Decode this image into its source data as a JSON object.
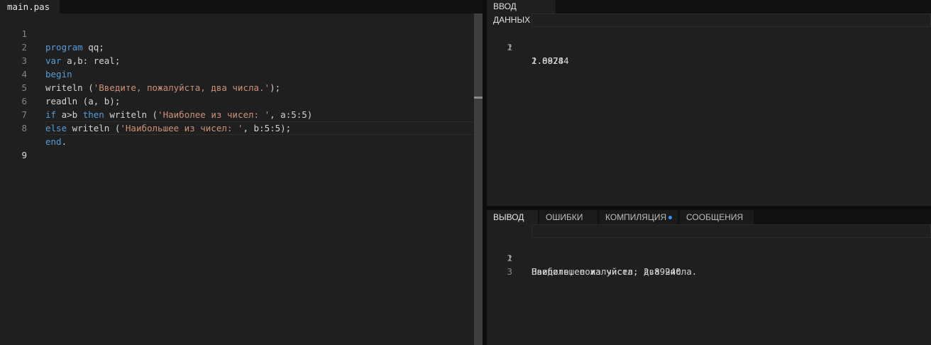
{
  "editor": {
    "tab_label": "main.pas",
    "line_numbers": [
      "1",
      "2",
      "3",
      "4",
      "5",
      "6",
      "7",
      "8",
      "9"
    ],
    "l1_kw": "program",
    "l1_rest": " qq;",
    "l2_kw": "var",
    "l2_rest": " a,b: real;",
    "l3_kw": "begin",
    "l4_a": "writeln (",
    "l4_str": "'Введите, пожалуйста, два числа.'",
    "l4_b": ");",
    "l5": "readln (a, b);",
    "l6_kw1": "if",
    "l6_a": " a>b ",
    "l6_kw2": "then",
    "l6_b": " writeln (",
    "l6_str": "'Наиболее из чисел: '",
    "l6_c": ", a:5:5)",
    "l7_kw": "else",
    "l7_a": " writeln (",
    "l7_str": "'Наибольшее из чисел: '",
    "l7_b": ", b:5:5);",
    "l8_kw": "end",
    "l8_rest": "."
  },
  "input_panel": {
    "tab_label": "ВВОД ДАННЫХ",
    "lines": [
      {
        "n": "1",
        "text": "1.08784"
      },
      {
        "n": "2",
        "text": "2.8924"
      }
    ]
  },
  "output_panel": {
    "tabs": [
      {
        "label": "ВЫВОД"
      },
      {
        "label": "ОШИБКИ"
      },
      {
        "label": "КОМПИЛЯЦИЯ"
      },
      {
        "label": "СООБЩЕНИЯ"
      }
    ],
    "lines": [
      {
        "n": "1",
        "text": "Введите, пожалуйста, два числа."
      },
      {
        "n": "2",
        "text": "Наибольшее из чисел: 2.89240"
      },
      {
        "n": "3",
        "text": ""
      }
    ]
  },
  "colors": {
    "keyword": "#569cd6",
    "string": "#ce9178",
    "text": "#d4d4d4",
    "line_number": "#858585",
    "background": "#1f1f1f",
    "compile_indicator": "#3794ff"
  }
}
